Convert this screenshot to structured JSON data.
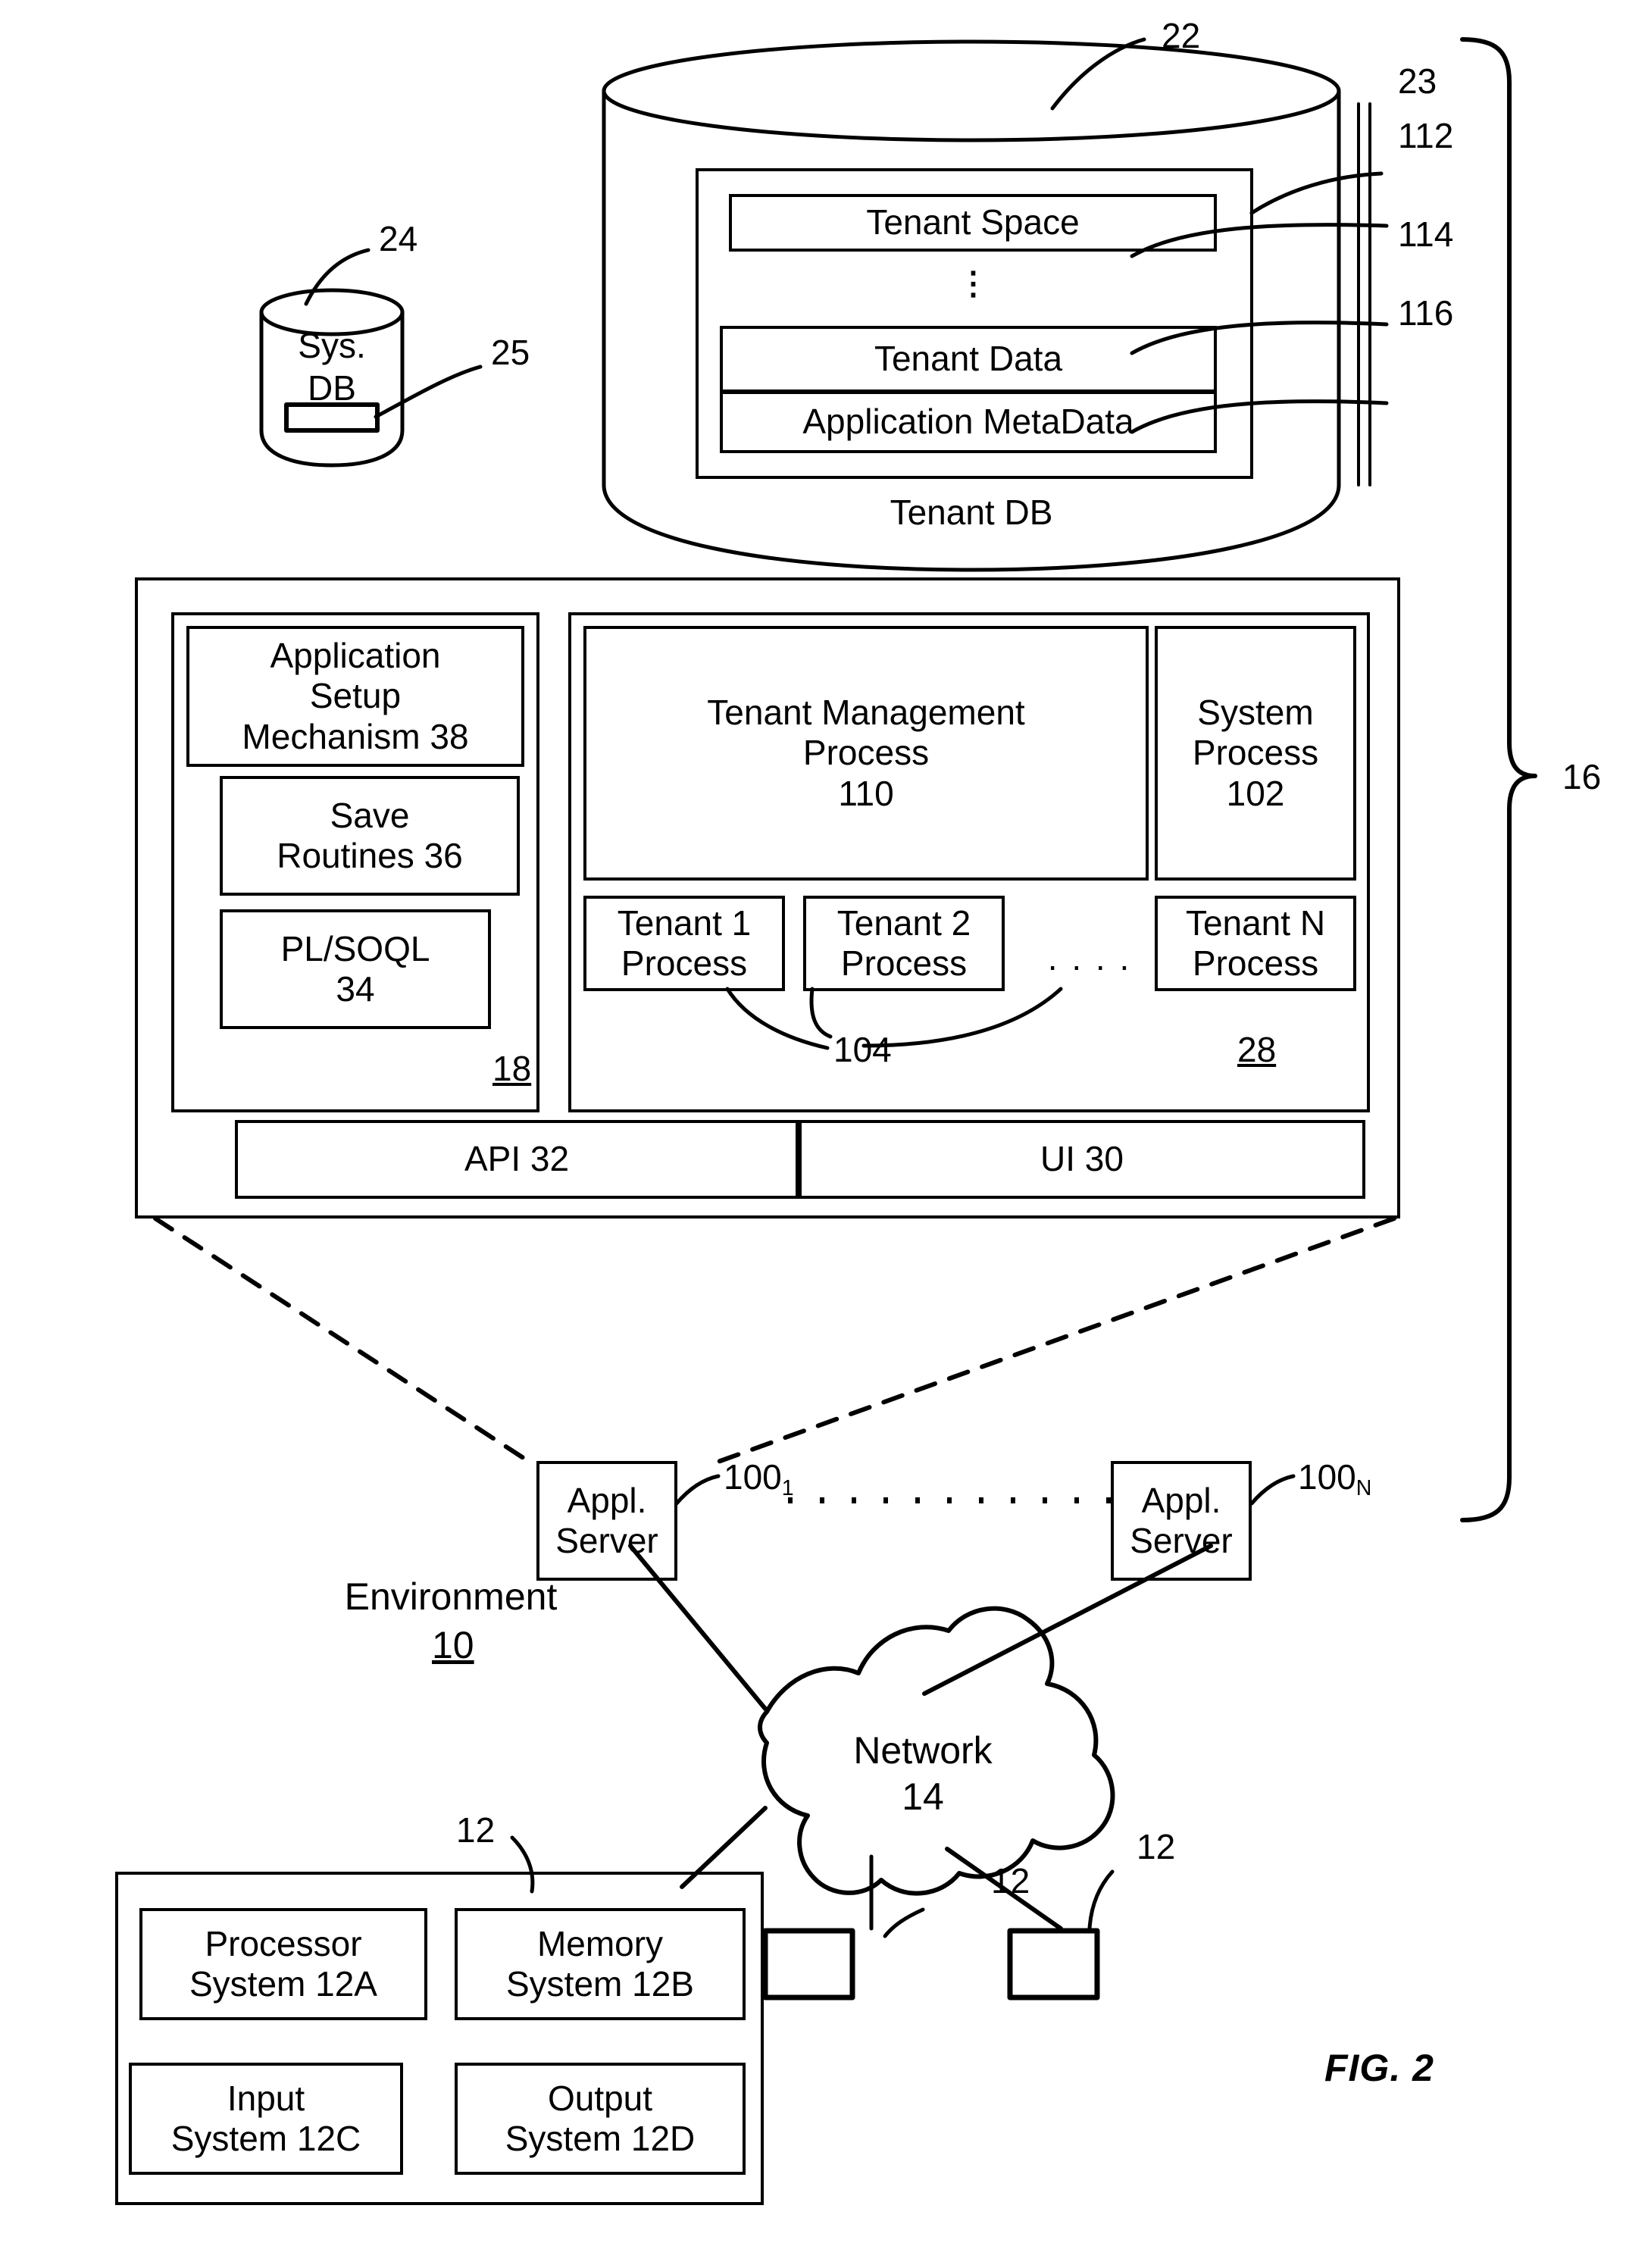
{
  "figure": {
    "caption": "FIG. 2"
  },
  "sys_db": {
    "label": "Sys.\nDB",
    "ref_cylinder": "24",
    "ref_slot": "25"
  },
  "tenant_db": {
    "caption": "Tenant DB",
    "ref_cylinder": "22",
    "ref_inner": "23",
    "vertical_dots": "⋮",
    "rows": [
      {
        "label": "Tenant Space",
        "ref": "112"
      },
      {
        "label": "Tenant Data",
        "ref": "114"
      },
      {
        "label": "Application MetaData",
        "ref": "116"
      }
    ]
  },
  "system_bracket": {
    "ref": "16"
  },
  "platform": {
    "left_stack": {
      "ref": "18",
      "items": [
        {
          "label": "Application\nSetup\nMechanism 38"
        },
        {
          "label": "Save\nRoutines 36"
        },
        {
          "label": "PL/SOQL\n34"
        }
      ]
    },
    "process_space": {
      "ref_tenant_processes": "104",
      "ref_process_space": "28",
      "tenant_management": "Tenant Management\nProcess\n110",
      "system_process": "System\nProcess\n102",
      "tenant_processes": [
        "Tenant 1\nProcess",
        "Tenant 2\nProcess",
        "Tenant N\nProcess"
      ],
      "ellipsis": ". . . ."
    },
    "bottom_bar": [
      {
        "label": "API 32"
      },
      {
        "label": "UI 30"
      }
    ]
  },
  "app_servers": [
    {
      "label": "Appl.\nServer",
      "ref": "100",
      "sub": "1"
    },
    {
      "label": "Appl.\nServer",
      "ref": "100",
      "sub": "N"
    }
  ],
  "app_server_ellipsis": ". . . . . . . . .",
  "environment": {
    "label": "Environment",
    "ref": "10"
  },
  "network": {
    "label": "Network\n14"
  },
  "user_system": {
    "ref": "12",
    "components": [
      {
        "label": "Processor\nSystem 12A"
      },
      {
        "label": "Memory\nSystem 12B"
      },
      {
        "label": "Input\nSystem 12C"
      },
      {
        "label": "Output\nSystem 12D"
      }
    ]
  },
  "other_user_systems": [
    {
      "ref": "12"
    },
    {
      "ref": "12"
    }
  ]
}
